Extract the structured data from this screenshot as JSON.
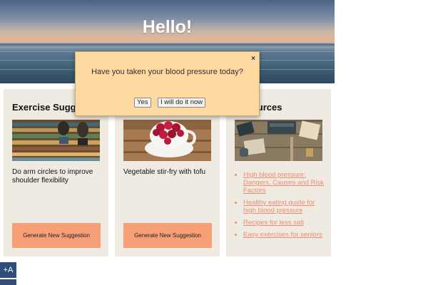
{
  "hero": {
    "title": "Hello!",
    "subtitle": ""
  },
  "cards": {
    "exercise": {
      "heading": "Exercise Suggestion",
      "description": "Do arm circles to improve shoulder flexibility",
      "button_label": "Generate New Suggestion",
      "image": "bench-feet-photo"
    },
    "recipe": {
      "heading": "",
      "description": "Vegetable stir-fry with tofu",
      "button_label": "Generate New Suggestion",
      "image": "raspberries-cup-photo"
    },
    "resources": {
      "heading": "Resources",
      "image": "typewriter-desk-photo",
      "links": [
        "High blood pressure: Dangers, Causes and Risk Factors",
        "Healthy eating guide for high blood pressure",
        "Recipes for less salt",
        "Easy exercises for seniors"
      ]
    }
  },
  "modal": {
    "question": "Have you taken your blood pressure today?",
    "close_label": "×",
    "yes_label": "Yes",
    "later_label": "I will do it now"
  },
  "accessibility": {
    "increase_font_label": "+A"
  },
  "colors": {
    "card_bg": "#efebe2",
    "button_bg": "#f7a078",
    "link": "#ef8a72",
    "modal_bg": "#fdd8a0",
    "a11y_bg": "#2f4f7a"
  }
}
